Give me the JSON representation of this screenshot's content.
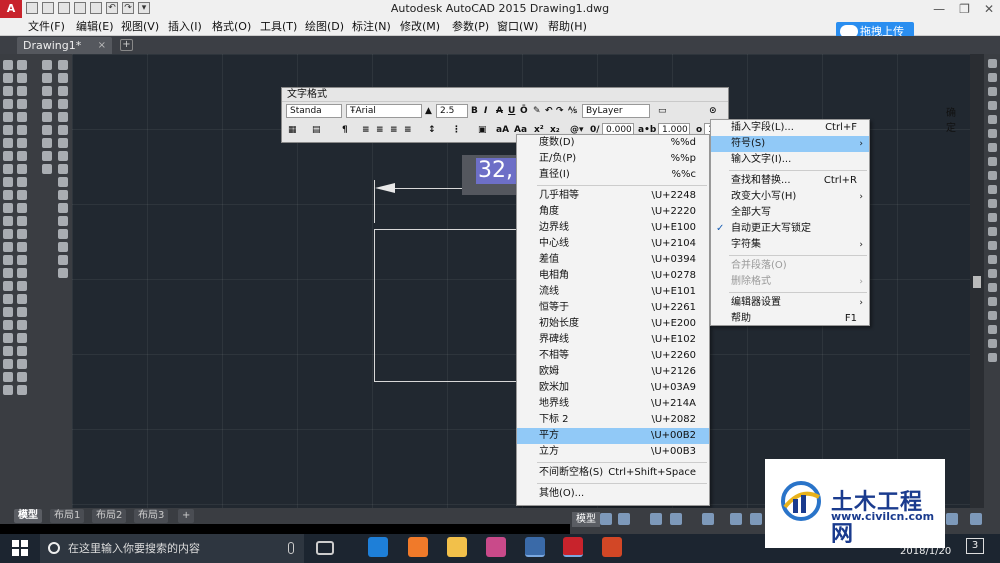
{
  "window": {
    "title": "Autodesk AutoCAD 2015    Drawing1.dwg",
    "app_logo": "A"
  },
  "menu": [
    "文件(F)",
    "编辑(E)",
    "视图(V)",
    "插入(I)",
    "格式(O)",
    "工具(T)",
    "绘图(D)",
    "标注(N)",
    "修改(M)",
    "参数(P)",
    "窗口(W)",
    "帮助(H)"
  ],
  "upload_button": "拖拽上传",
  "doc_tab": {
    "label": "Drawing1*",
    "close": "×",
    "new": "+"
  },
  "text_format": {
    "caption": "文字格式",
    "style": "Standa",
    "font": "Arial",
    "height": "2.5",
    "bold": "B",
    "italic": "I",
    "strike": "A",
    "underline": "U",
    "overline": "Ō",
    "color": "ByLayer",
    "ok": "确定",
    "oblique": "0.000",
    "tracking": "1.000",
    "width": "1.00"
  },
  "edit_text": "32,",
  "symbol_menu": {
    "group1": [
      {
        "label": "度数(D)",
        "code": "%%d"
      },
      {
        "label": "正/负(P)",
        "code": "%%p"
      },
      {
        "label": "直径(I)",
        "code": "%%c"
      }
    ],
    "group2": [
      {
        "label": "几乎相等",
        "code": "\\U+2248"
      },
      {
        "label": "角度",
        "code": "\\U+2220"
      },
      {
        "label": "边界线",
        "code": "\\U+E100"
      },
      {
        "label": "中心线",
        "code": "\\U+2104"
      },
      {
        "label": "差值",
        "code": "\\U+0394"
      },
      {
        "label": "电相角",
        "code": "\\U+0278"
      },
      {
        "label": "流线",
        "code": "\\U+E101"
      },
      {
        "label": "恒等于",
        "code": "\\U+2261"
      },
      {
        "label": "初始长度",
        "code": "\\U+E200"
      },
      {
        "label": "界碑线",
        "code": "\\U+E102"
      },
      {
        "label": "不相等",
        "code": "\\U+2260"
      },
      {
        "label": "欧姆",
        "code": "\\U+2126"
      },
      {
        "label": "欧米加",
        "code": "\\U+03A9"
      },
      {
        "label": "地界线",
        "code": "\\U+214A"
      },
      {
        "label": "下标 2",
        "code": "\\U+2082"
      },
      {
        "label": "平方",
        "code": "\\U+00B2"
      },
      {
        "label": "立方",
        "code": "\\U+00B3"
      }
    ],
    "group3": [
      {
        "label": "不间断空格(S)",
        "code": "Ctrl+Shift+Space"
      }
    ],
    "group4": [
      {
        "label": "其他(O)...",
        "code": ""
      }
    ]
  },
  "context_menu": {
    "insert_field": {
      "label": "插入字段(L)...",
      "shortcut": "Ctrl+F"
    },
    "symbol": {
      "label": "符号(S)",
      "arrow": "›"
    },
    "input_text": {
      "label": "输入文字(I)..."
    },
    "find_replace": {
      "label": "查找和替换...",
      "shortcut": "Ctrl+R"
    },
    "change_case": {
      "label": "改变大小写(H)",
      "arrow": "›"
    },
    "all_caps": {
      "label": "全部大写"
    },
    "autocaps": {
      "label": "自动更正大写锁定",
      "check": "✓"
    },
    "charset": {
      "label": "字符集",
      "arrow": "›"
    },
    "combine": {
      "label": "合并段落(O)"
    },
    "remove_format": {
      "label": "删除格式",
      "arrow": "›"
    },
    "editor_settings": {
      "label": "编辑器设置",
      "arrow": "›"
    },
    "help": {
      "label": "帮助",
      "shortcut": "F1"
    }
  },
  "layout_tabs": [
    "模型",
    "布局1",
    "布局2",
    "布局3",
    "+"
  ],
  "status": {
    "model": "模型"
  },
  "taskbar": {
    "search_placeholder": "在这里输入你要搜索的内容",
    "date": "2018/1/20",
    "notifications": "3"
  },
  "watermark": {
    "name": "土木工程网",
    "url": "www.civilcn.com"
  }
}
